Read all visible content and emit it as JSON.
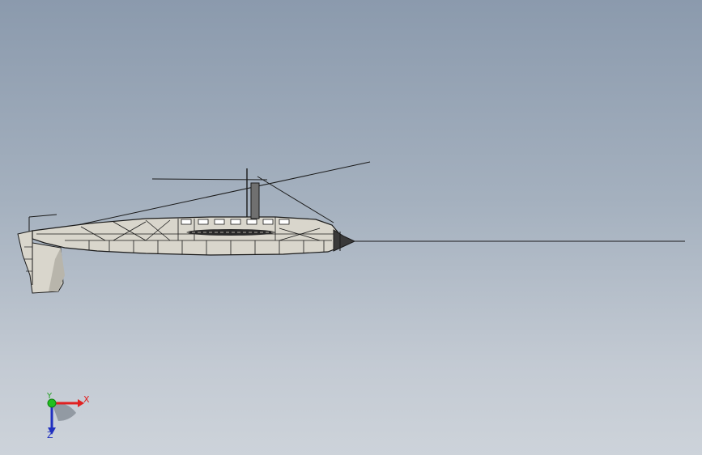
{
  "viewport": {
    "background_top": "#8b9aad",
    "background_bottom": "#cdd3da"
  },
  "model": {
    "line_color": "#1a1a1a",
    "hull_color": "#d9d6cc",
    "hull_shadow": "#b8b5ab"
  },
  "triad": {
    "x_label": "X",
    "y_label": "Y",
    "z_label": "Z",
    "x_color": "#e02020",
    "y_color": "#20a020",
    "z_color": "#2030c0"
  }
}
